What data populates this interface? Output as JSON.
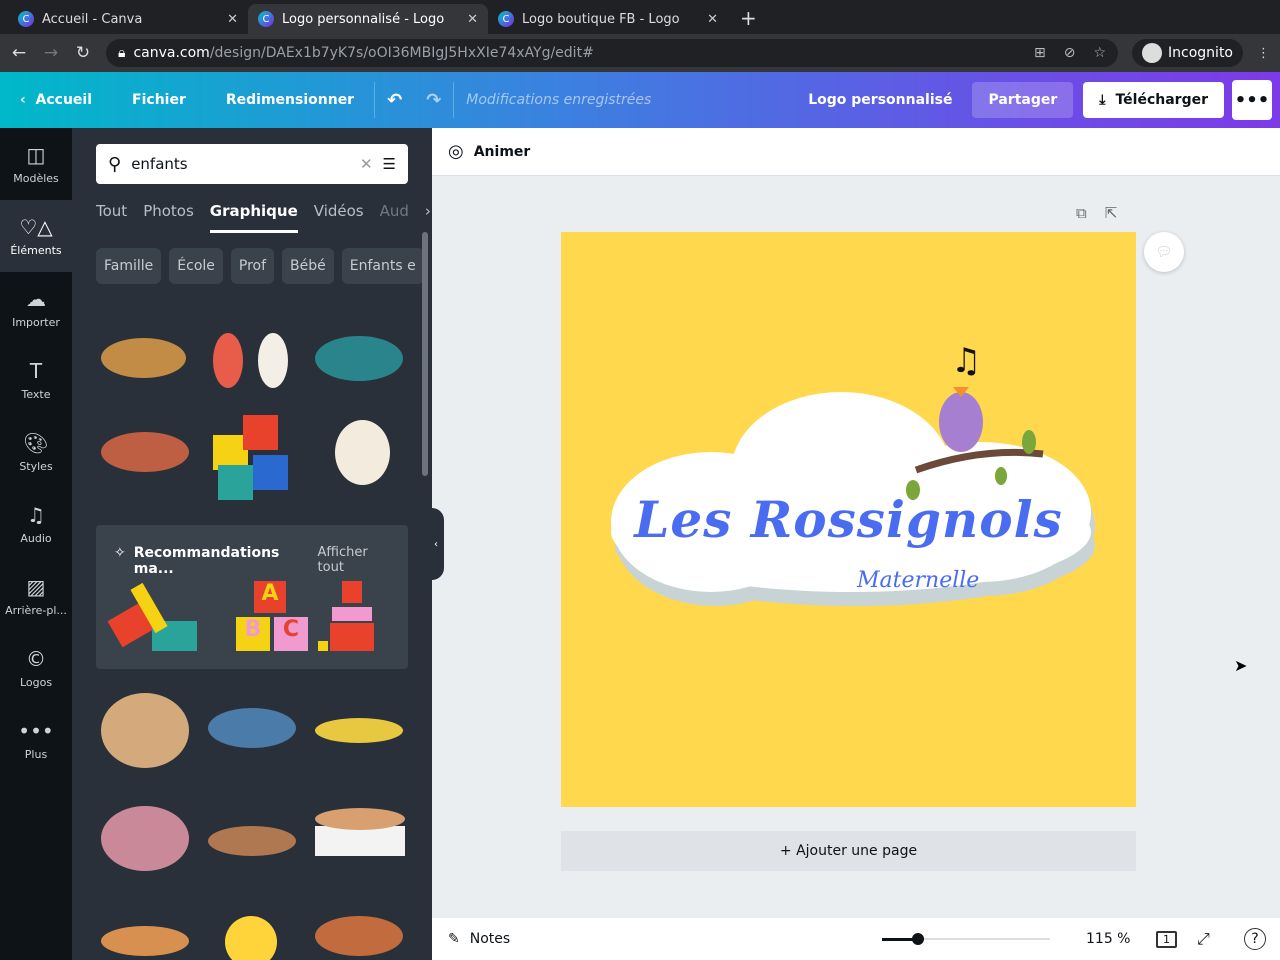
{
  "browser": {
    "tabs": [
      {
        "title": "Accueil - Canva"
      },
      {
        "title": "Logo personnalisé - Logo",
        "active": true
      },
      {
        "title": "Logo boutique FB - Logo"
      }
    ],
    "url_host": "canva.com",
    "url_path": "/design/DAEx1b7yK7s/oOI36MBIgJ5HxXIe74xAYg/edit#",
    "profile": "Incognito"
  },
  "toolbar": {
    "home": "Accueil",
    "file": "Fichier",
    "resize": "Redimensionner",
    "saved_status": "Modifications enregistrées",
    "design_title": "Logo personnalisé",
    "share": "Partager",
    "download": "Télécharger"
  },
  "rail": [
    {
      "label": "Modèles",
      "icon": "template-icon"
    },
    {
      "label": "Éléments",
      "icon": "elements-icon",
      "active": true
    },
    {
      "label": "Importer",
      "icon": "upload-icon"
    },
    {
      "label": "Texte",
      "icon": "text-icon"
    },
    {
      "label": "Styles",
      "icon": "palette-icon"
    },
    {
      "label": "Audio",
      "icon": "music-icon"
    },
    {
      "label": "Arrière-pl...",
      "icon": "background-icon"
    },
    {
      "label": "Logos",
      "icon": "logo-icon"
    },
    {
      "label": "Plus",
      "icon": "more-icon"
    }
  ],
  "panel": {
    "search_value": "enfants",
    "tabs": [
      "Tout",
      "Photos",
      "Graphique",
      "Vidéos",
      "Aud"
    ],
    "active_tab": "Graphique",
    "chips": [
      "Famille",
      "École",
      "Prof",
      "Bébé",
      "Enfants e"
    ],
    "reco_title": "Recommandations ma...",
    "reco_all": "Afficher tout"
  },
  "editor": {
    "animate": "Animer",
    "logo_title": "Les Rossignols",
    "logo_subtitle": "Maternelle",
    "add_page": "+ Ajouter une page",
    "canvas_color": "#ffd84d",
    "text_color": "#4a6cf0"
  },
  "footer": {
    "notes": "Notes",
    "zoom": "115 %",
    "zoom_value": 115,
    "page_count": "1"
  }
}
